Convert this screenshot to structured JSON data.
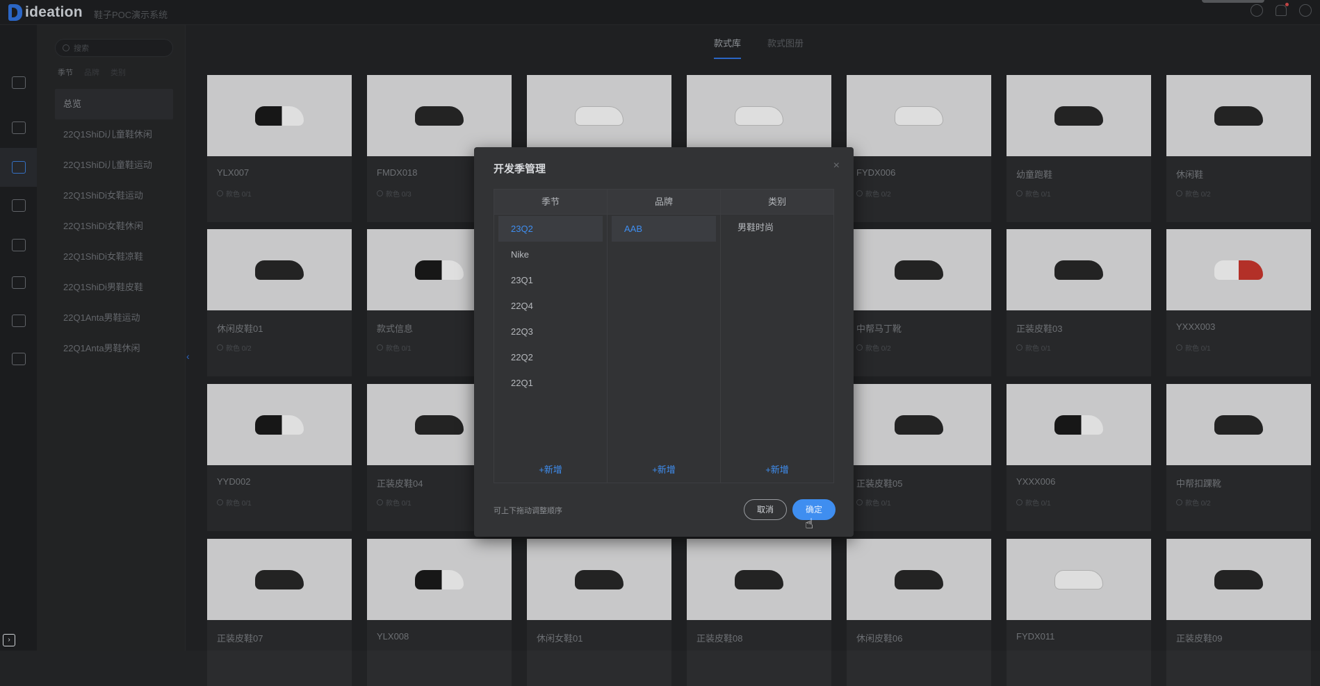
{
  "header": {
    "logo_text": "ideation",
    "app_name": "鞋子POC演示系统"
  },
  "sidebar": {
    "search_placeholder": "搜索",
    "filters": [
      "季节",
      "品牌",
      "类别"
    ],
    "items": [
      "总览",
      "22Q1ShiDi儿童鞋休闲",
      "22Q1ShiDi儿童鞋运动",
      "22Q1ShiDi女鞋运动",
      "22Q1ShiDi女鞋休闲",
      "22Q1ShiDi女鞋凉鞋",
      "22Q1ShiDi男鞋皮鞋",
      "22Q1Anta男鞋运动",
      "22Q1Anta男鞋休闲"
    ]
  },
  "tabs": [
    "款式库",
    "款式图册"
  ],
  "cards": [
    {
      "name": "YLX007",
      "meta": "款色 0/1",
      "shoe": "mixed"
    },
    {
      "name": "FMDX018",
      "meta": "款色 0/3",
      "shoe": "dark"
    },
    {
      "name": "",
      "meta": "",
      "shoe": "white"
    },
    {
      "name": "",
      "meta": "",
      "shoe": "white"
    },
    {
      "name": "FYDX006",
      "meta": "款色 0/2",
      "shoe": "white"
    },
    {
      "name": "幼童跑鞋",
      "meta": "款色 0/1",
      "shoe": "dark"
    },
    {
      "name": "休闲鞋",
      "meta": "款色 0/2",
      "shoe": "dark"
    },
    {
      "name": "休闲皮鞋01",
      "meta": "款色 0/2",
      "shoe": "dark"
    },
    {
      "name": "款式信息",
      "meta": "款色 0/1",
      "shoe": "mixed"
    },
    {
      "name": "",
      "meta": "",
      "shoe": "dark"
    },
    {
      "name": "",
      "meta": "",
      "shoe": "dark"
    },
    {
      "name": "中帮马丁靴",
      "meta": "款色 0/2",
      "shoe": "dark"
    },
    {
      "name": "正装皮鞋03",
      "meta": "款色 0/1",
      "shoe": "dark"
    },
    {
      "name": "YXXX003",
      "meta": "款色 0/1",
      "shoe": "red"
    },
    {
      "name": "YYD002",
      "meta": "款色 0/1",
      "shoe": "mixed"
    },
    {
      "name": "正装皮鞋04",
      "meta": "款色 0/1",
      "shoe": "dark"
    },
    {
      "name": "",
      "meta": "",
      "shoe": "dark"
    },
    {
      "name": "",
      "meta": "",
      "shoe": "dark"
    },
    {
      "name": "正装皮鞋05",
      "meta": "款色 0/1",
      "shoe": "dark"
    },
    {
      "name": "YXXX006",
      "meta": "款色 0/1",
      "shoe": "mixed"
    },
    {
      "name": "中帮扣踝靴",
      "meta": "款色 0/2",
      "shoe": "dark"
    },
    {
      "name": "正装皮鞋07",
      "meta": "",
      "shoe": "dark"
    },
    {
      "name": "YLX008",
      "meta": "",
      "shoe": "mixed"
    },
    {
      "name": "休闲女鞋01",
      "meta": "",
      "shoe": "dark"
    },
    {
      "name": "正装皮鞋08",
      "meta": "",
      "shoe": "dark"
    },
    {
      "name": "休闲皮鞋06",
      "meta": "",
      "shoe": "dark"
    },
    {
      "name": "FYDX011",
      "meta": "",
      "shoe": "white"
    },
    {
      "name": "正装皮鞋09",
      "meta": "",
      "shoe": "dark"
    }
  ],
  "modal": {
    "title": "开发季管理",
    "columns": [
      {
        "header": "季节",
        "items": [
          "23Q2",
          "Nike",
          "23Q1",
          "22Q4",
          "22Q3",
          "22Q2",
          "22Q1"
        ],
        "selected": 0
      },
      {
        "header": "品牌",
        "items": [
          "AAB"
        ],
        "selected": 0
      },
      {
        "header": "类别",
        "items": [
          "男鞋时尚"
        ],
        "selected": -1
      }
    ],
    "add_label": "+新增",
    "hint": "可上下拖动调整顺序",
    "cancel_label": "取消",
    "ok_label": "确定"
  }
}
